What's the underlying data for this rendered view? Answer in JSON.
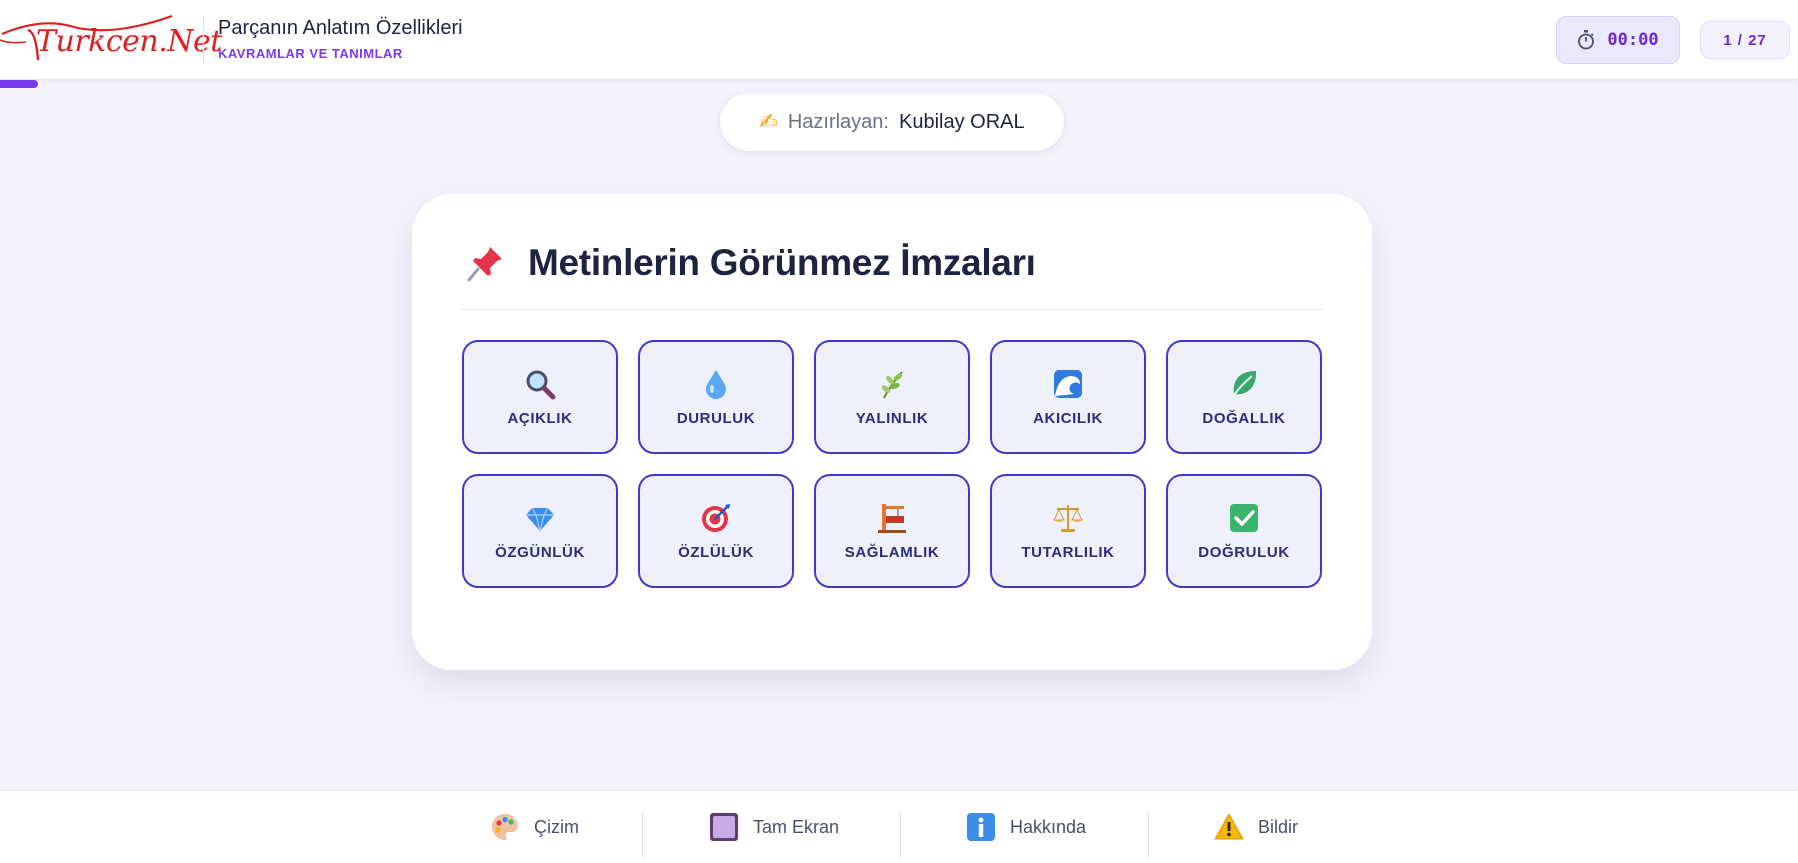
{
  "header": {
    "logo_text": "Turkcen.Net",
    "title": "Parçanın Anlatım Özellikleri",
    "subtitle": "KAVRAMLAR VE TANIMLAR",
    "timer": "00:00",
    "counter": "1 / 27"
  },
  "author": {
    "icon": "writing-hand-icon",
    "label": "Hazırlayan:",
    "name": "Kubilay ORAL"
  },
  "card": {
    "title": "Metinlerin Görünmez İmzaları",
    "title_icon": "pushpin-icon",
    "tiles": [
      {
        "label": "AÇIKLIK",
        "icon": "magnifier-icon"
      },
      {
        "label": "DURULUK",
        "icon": "droplet-icon"
      },
      {
        "label": "YALINLIK",
        "icon": "herb-icon"
      },
      {
        "label": "AKICILIK",
        "icon": "wave-icon"
      },
      {
        "label": "DOĞALLIK",
        "icon": "leaf-icon"
      },
      {
        "label": "ÖZGÜNLÜK",
        "icon": "gem-icon"
      },
      {
        "label": "ÖZLÜLÜK",
        "icon": "target-icon"
      },
      {
        "label": "SAĞLAMLIK",
        "icon": "construction-icon"
      },
      {
        "label": "TUTARLILIK",
        "icon": "scales-icon"
      },
      {
        "label": "DOĞRULUK",
        "icon": "check-icon"
      }
    ]
  },
  "footer": {
    "buttons": [
      {
        "label": "Çizim",
        "icon": "palette-icon"
      },
      {
        "label": "Tam Ekran",
        "icon": "square-icon"
      },
      {
        "label": "Hakkında",
        "icon": "info-icon"
      },
      {
        "label": "Bildir",
        "icon": "warning-icon"
      }
    ]
  },
  "colors": {
    "accent": "#7c3aed",
    "tile_border": "#4338ca",
    "tile_bg": "#eef0fb",
    "page_bg": "#f3f2fd"
  }
}
